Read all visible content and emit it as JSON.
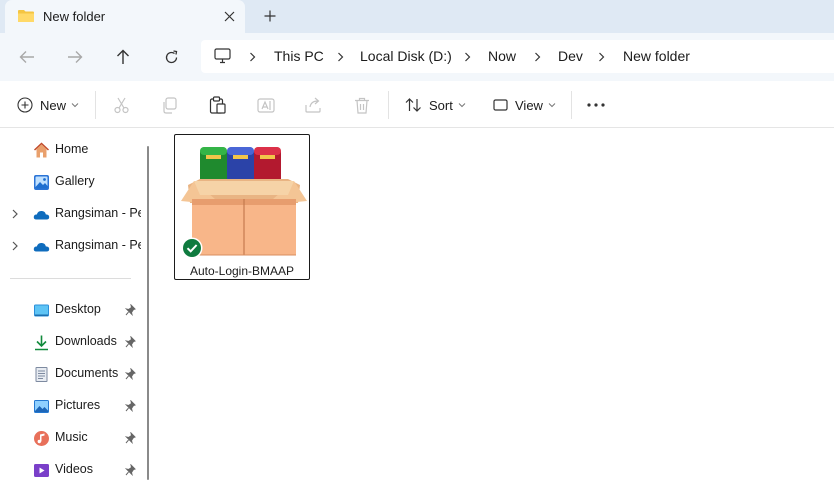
{
  "tab": {
    "title": "New folder",
    "close_icon": "close-icon",
    "new_tab_icon": "plus-icon"
  },
  "nav": {
    "back_icon": "arrow-left-icon",
    "forward_icon": "arrow-right-icon",
    "up_icon": "arrow-up-icon",
    "refresh_icon": "refresh-icon"
  },
  "breadcrumb": {
    "root_icon": "monitor-icon",
    "items": [
      "This PC",
      "Local Disk (D:)",
      "Now",
      "Dev",
      "New folder"
    ]
  },
  "commands": {
    "new_label": "New",
    "sort_label": "Sort",
    "view_label": "View",
    "disabled_icons": [
      "cut-icon",
      "copy-icon",
      "paste-icon",
      "rename-icon",
      "share-icon",
      "delete-icon"
    ],
    "more_icon": "more-icon"
  },
  "sidebar": {
    "top_items": [
      {
        "label": "Home",
        "icon": "home-icon"
      },
      {
        "label": "Gallery",
        "icon": "gallery-icon"
      },
      {
        "label": "Rangsiman - Pe",
        "icon": "onedrive-icon",
        "expandable": true
      },
      {
        "label": "Rangsiman - Pe",
        "icon": "onedrive-icon",
        "expandable": true
      }
    ],
    "quick_access": [
      {
        "label": "Desktop",
        "icon": "desktop-icon",
        "pinned": true
      },
      {
        "label": "Downloads",
        "icon": "download-icon",
        "pinned": true
      },
      {
        "label": "Documents",
        "icon": "documents-icon",
        "pinned": true
      },
      {
        "label": "Pictures",
        "icon": "pictures-icon",
        "pinned": true
      },
      {
        "label": "Music",
        "icon": "music-icon",
        "pinned": true
      },
      {
        "label": "Videos",
        "icon": "videos-icon",
        "pinned": true
      }
    ]
  },
  "files": [
    {
      "name": "Auto-Login-BMAAP",
      "icon": "archive-box-icon",
      "status": "synced",
      "selected": true
    }
  ],
  "colors": {
    "titlebar": "#dfe9f4",
    "navbar": "#f3f7fb",
    "accent": "#0067c0",
    "sync_green": "#0f7b3f"
  }
}
